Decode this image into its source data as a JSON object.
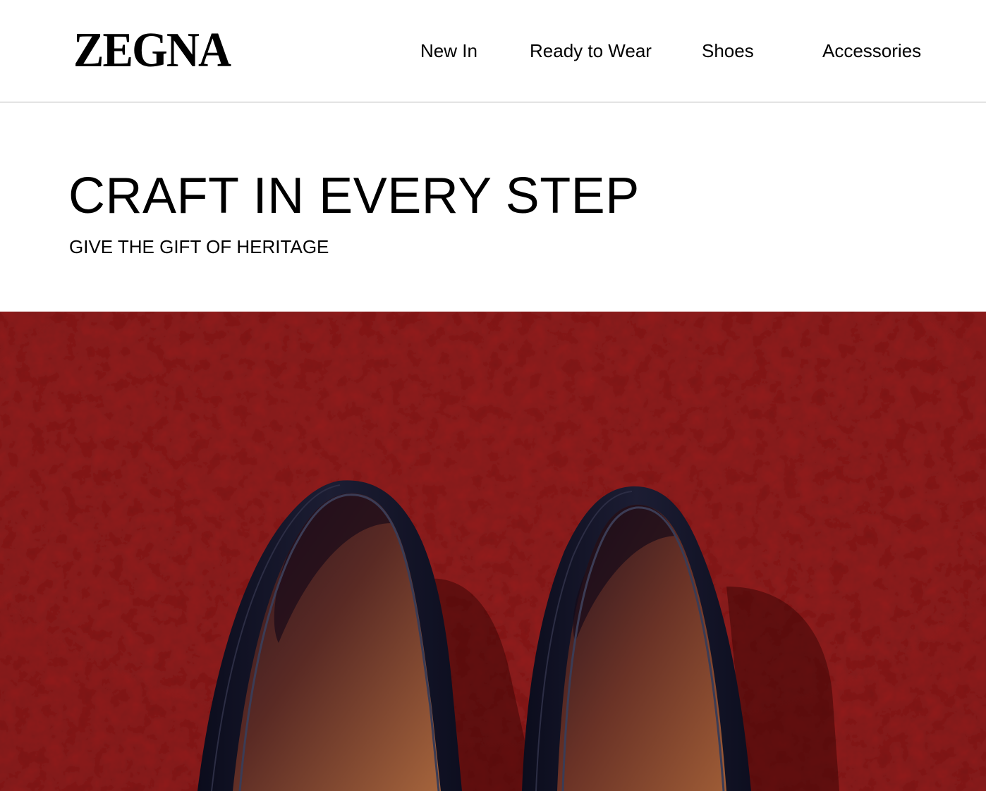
{
  "brand": {
    "logo_text": "ZEGNA"
  },
  "nav": {
    "items": [
      {
        "label": "New In"
      },
      {
        "label": "Ready to Wear"
      },
      {
        "label": "Shoes"
      },
      {
        "label": "Accessories"
      }
    ]
  },
  "hero": {
    "title": "CRAFT IN EVERY STEP",
    "subtitle": "GIVE THE GIFT OF HERITAGE",
    "image": {
      "subject": "pair of dark navy leather loafers on textured red surface",
      "background_color": "#7a1414",
      "shoe_color": "#14152a",
      "lining_color": "#9a5a36"
    }
  },
  "colors": {
    "text": "#000000",
    "background": "#ffffff",
    "divider": "#e3e3e3"
  }
}
